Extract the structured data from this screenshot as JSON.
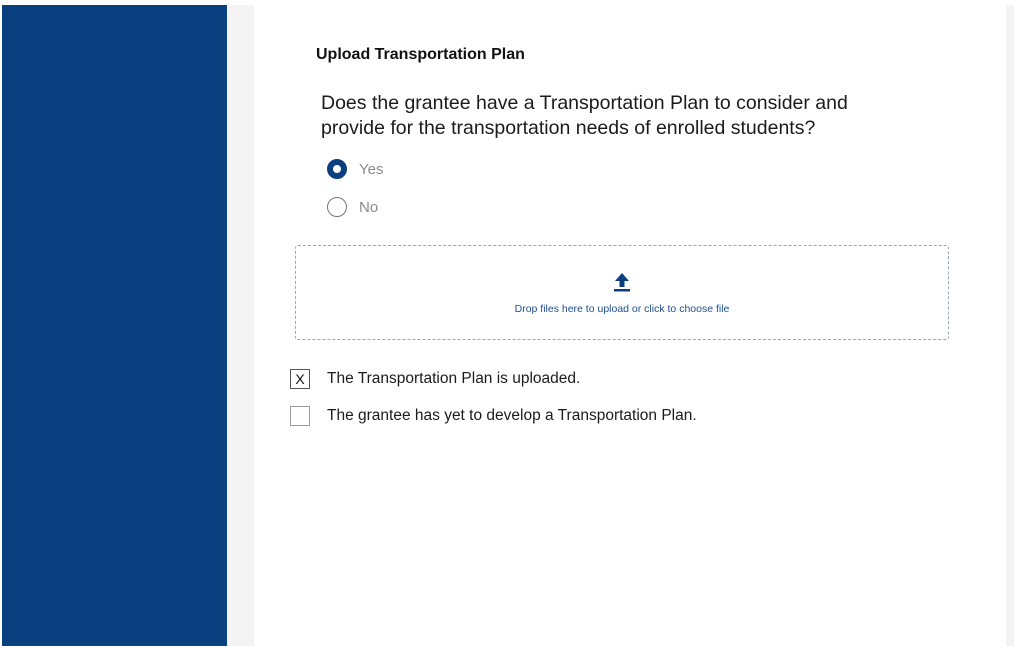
{
  "section": {
    "title": "Upload Transportation Plan"
  },
  "question": {
    "text": "Does the grantee have a Transportation Plan to consider and provide for the transportation needs of enrolled students?",
    "options": [
      {
        "label": "Yes",
        "selected": true
      },
      {
        "label": "No",
        "selected": false
      }
    ]
  },
  "dropzone": {
    "icon": "upload-icon",
    "text": "Drop files here to upload or click to choose file"
  },
  "checkboxes": [
    {
      "mark": "X",
      "label": "The Transportation Plan is uploaded.",
      "checked": true
    },
    {
      "mark": "",
      "label": "The grantee has yet to develop a Transportation Plan.",
      "checked": false
    }
  ],
  "colors": {
    "sidebar": "#0b4080",
    "accent": "#0b4080",
    "dropzone_text": "#1d4f91"
  }
}
